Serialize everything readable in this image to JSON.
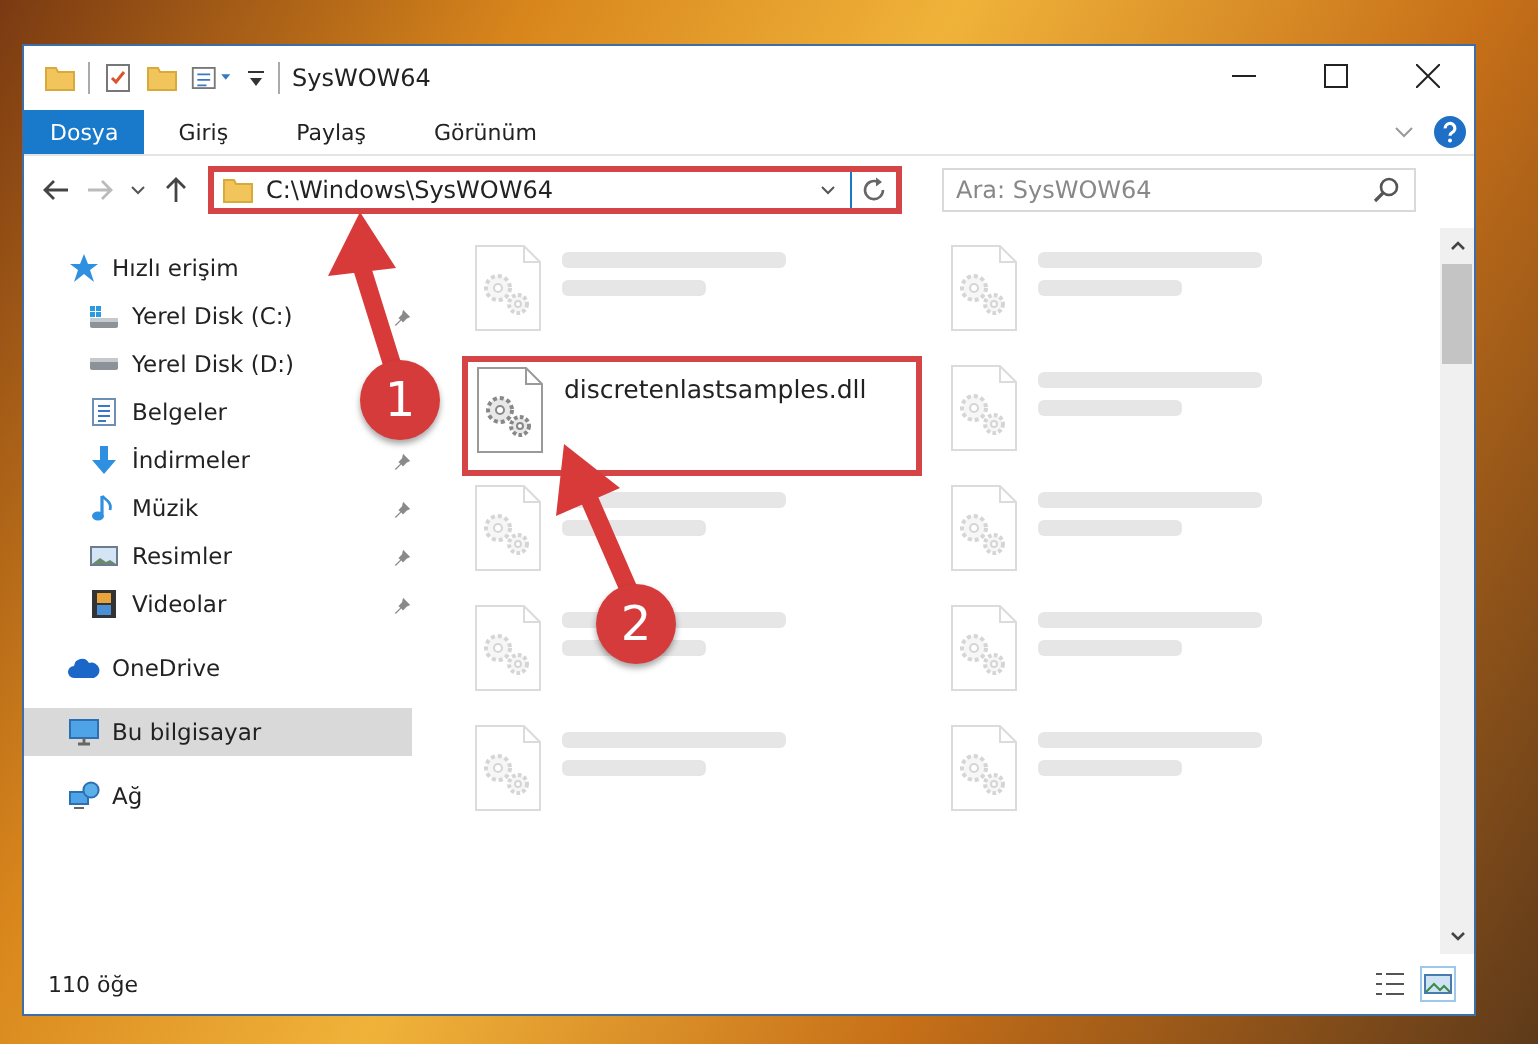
{
  "window": {
    "title": "SysWOW64"
  },
  "ribbon_tabs": [
    {
      "label": "Dosya",
      "kind": "file",
      "selected": false
    },
    {
      "label": "Giriş",
      "kind": "tab",
      "selected": false
    },
    {
      "label": "Paylaş",
      "kind": "tab",
      "selected": false
    },
    {
      "label": "Görünüm",
      "kind": "tab",
      "selected": false
    }
  ],
  "address_bar": {
    "path": "C:\\Windows\\SysWOW64",
    "highlighted": true
  },
  "search": {
    "placeholder": "Ara: SysWOW64"
  },
  "sidebar": {
    "items": [
      {
        "label": "Hızlı erişim",
        "kind": "star",
        "selected": false,
        "children": [
          {
            "label": "Yerel Disk (C:)",
            "kind": "drive-c",
            "pinned": true,
            "selected": false
          },
          {
            "label": "Yerel Disk (D:)",
            "kind": "drive",
            "pinned": false,
            "selected": false
          },
          {
            "label": "Belgeler",
            "kind": "document",
            "pinned": false,
            "selected": false
          },
          {
            "label": "İndirmeler",
            "kind": "download",
            "pinned": true,
            "selected": false
          },
          {
            "label": "Müzik",
            "kind": "music",
            "pinned": true,
            "selected": false
          },
          {
            "label": "Resimler",
            "kind": "pictures",
            "pinned": true,
            "selected": false
          },
          {
            "label": "Videolar",
            "kind": "video",
            "pinned": true,
            "selected": false
          }
        ]
      },
      {
        "label": "OneDrive",
        "kind": "cloud",
        "selected": false
      },
      {
        "label": "Bu bilgisayar",
        "kind": "computer",
        "selected": true
      },
      {
        "label": "Ağ",
        "kind": "network",
        "selected": false
      }
    ]
  },
  "files": [
    {
      "kind": "blurred",
      "highlighted": false
    },
    {
      "kind": "blurred",
      "highlighted": false
    },
    {
      "kind": "file",
      "name": "discretenlastsamples.dll",
      "highlighted": true
    },
    {
      "kind": "blurred",
      "highlighted": false
    },
    {
      "kind": "blurred",
      "highlighted": false
    },
    {
      "kind": "blurred",
      "highlighted": false
    },
    {
      "kind": "blurred",
      "highlighted": false
    },
    {
      "kind": "blurred",
      "highlighted": false
    },
    {
      "kind": "blurred",
      "highlighted": false
    },
    {
      "kind": "blurred",
      "highlighted": false
    }
  ],
  "status_bar": {
    "item_count": "110 öğe"
  },
  "annotations": [
    {
      "label": "1"
    },
    {
      "label": "2"
    }
  ]
}
